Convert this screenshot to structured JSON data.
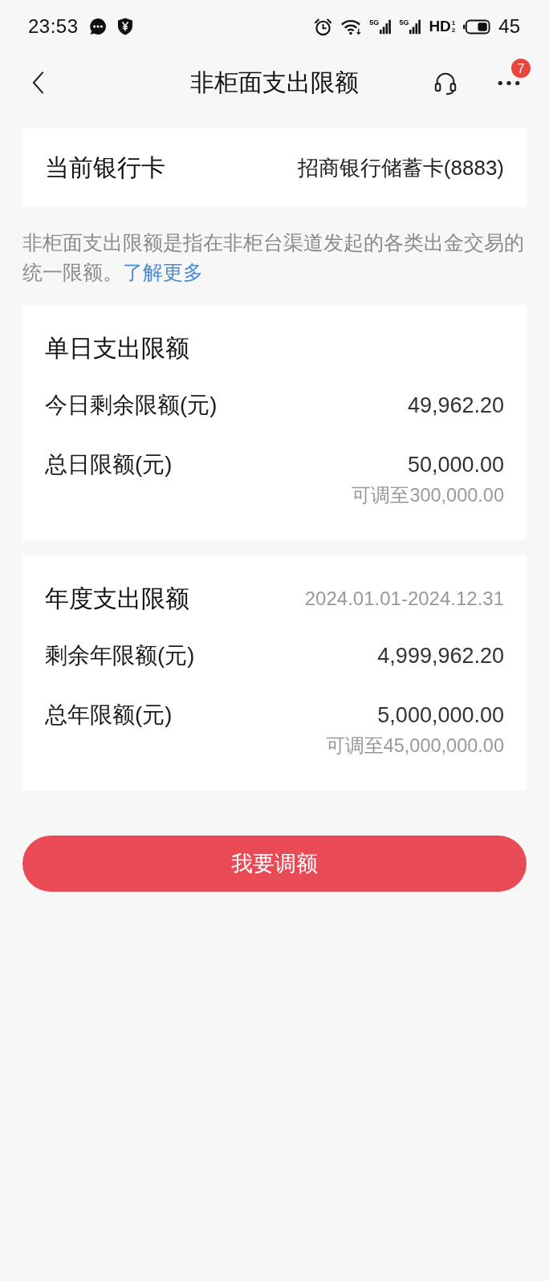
{
  "status_bar": {
    "time": "23:53",
    "signals": [
      {
        "label": "5G"
      },
      {
        "label": "5G"
      }
    ],
    "hd": {
      "label": "HD",
      "sims": [
        "1",
        "2"
      ]
    },
    "battery_text": "45"
  },
  "header": {
    "title": "非柜面支出限额",
    "badge": "7"
  },
  "current_card": {
    "label": "当前银行卡",
    "value": "招商银行储蓄卡(8883)"
  },
  "description": {
    "text": "非柜面支出限额是指在非柜台渠道发起的各类出金交易的统一限额。",
    "link": "了解更多"
  },
  "sections": [
    {
      "title": "单日支出限额",
      "rows": [
        {
          "label": "今日剩余限额(元)",
          "value": "49,962.20"
        },
        {
          "label": "总日限额(元)",
          "value": "50,000.00",
          "note": "可调至300,000.00"
        }
      ]
    },
    {
      "title": "年度支出限额",
      "period": "2024.01.01-2024.12.31",
      "rows": [
        {
          "label": "剩余年限额(元)",
          "value": "4,999,962.20"
        },
        {
          "label": "总年限额(元)",
          "value": "5,000,000.00",
          "note": "可调至45,000,000.00"
        }
      ]
    }
  ],
  "button": {
    "label": "我要调额"
  }
}
